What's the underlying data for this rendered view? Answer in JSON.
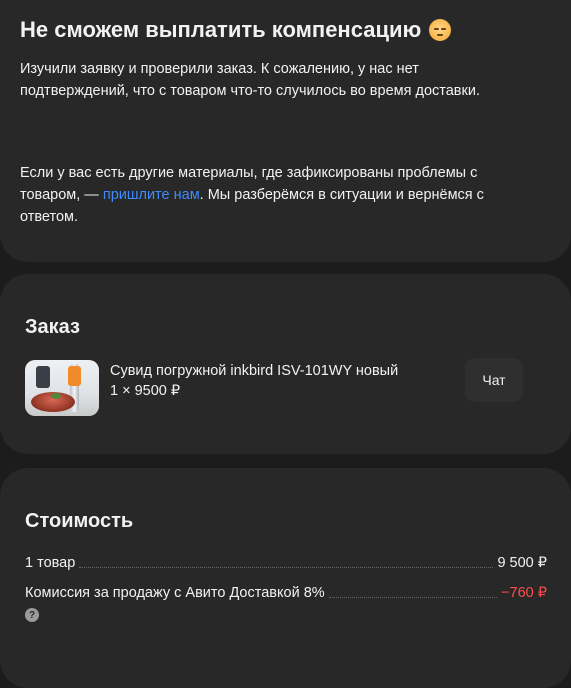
{
  "message": {
    "title": "Не сможем выплатить компенсацию",
    "emoji_icon": "pensive-face-icon",
    "paragraph1": "Изучили заявку и проверили заказ. К сожалению, у нас нет подтверждений, что с товаром что-то случилось во время доставки.",
    "paragraph2_before": "Если у вас есть другие материалы, где зафиксированы проблемы с товаром, — ",
    "paragraph2_link": "пришлите нам",
    "paragraph2_after": ". Мы разберёмся в ситуации и вернёмся с ответом."
  },
  "order": {
    "title": "Заказ",
    "item": {
      "name": "Сувид погружной inkbird ISV-101WY новый",
      "qty_price": "1 × 9500 ₽"
    },
    "chat_label": "Чат"
  },
  "cost": {
    "title": "Стоимость",
    "rows": [
      {
        "label": "1 товар",
        "value": "9 500 ₽"
      },
      {
        "label": "Комиссия за продажу с Авито Доставкой 8%",
        "value": "−760 ₽"
      }
    ],
    "help_glyph": "?"
  },
  "colors": {
    "link": "#3d8bff",
    "negative": "#ff4d4d",
    "card": "#282828",
    "background": "#1c1c1c"
  }
}
